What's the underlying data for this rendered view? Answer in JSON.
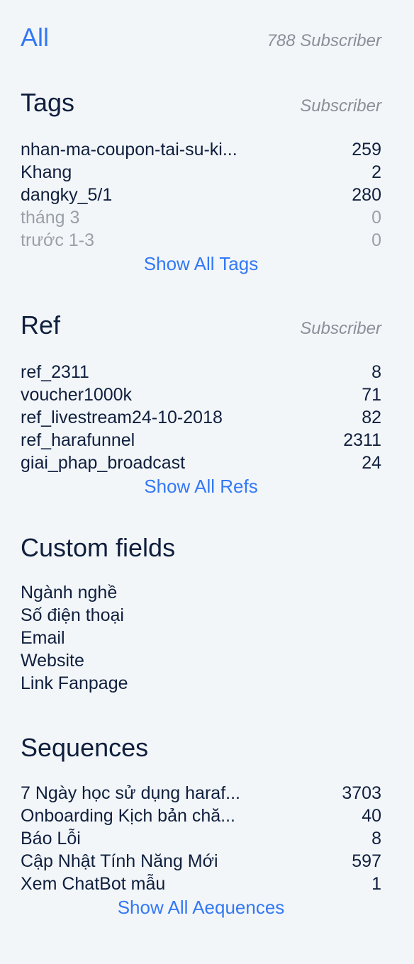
{
  "all": {
    "label": "All",
    "subscriber_text": "788 Subscriber"
  },
  "tags": {
    "title": "Tags",
    "column_label": "Subscriber",
    "items": [
      {
        "name": "nhan-ma-coupon-tai-su-ki...",
        "count": "259"
      },
      {
        "name": "Khang",
        "count": "2"
      },
      {
        "name": "dangky_5/1",
        "count": "280"
      },
      {
        "name": "tháng 3",
        "count": "0"
      },
      {
        "name": "trước 1-3",
        "count": "0"
      }
    ],
    "show_all": "Show All Tags"
  },
  "ref": {
    "title": "Ref",
    "column_label": "Subscriber",
    "items": [
      {
        "name": "ref_2311",
        "count": "8"
      },
      {
        "name": "voucher1000k",
        "count": "71"
      },
      {
        "name": "ref_livestream24-10-2018",
        "count": "82"
      },
      {
        "name": "ref_harafunnel",
        "count": "2311"
      },
      {
        "name": "giai_phap_broadcast",
        "count": "24"
      }
    ],
    "show_all": "Show All Refs"
  },
  "custom_fields": {
    "title": "Custom fields",
    "items": [
      "Ngành nghề",
      "Số điện thoại",
      "Email",
      "Website",
      "Link Fanpage"
    ]
  },
  "sequences": {
    "title": "Sequences",
    "items": [
      {
        "name": "7 Ngày học sử dụng haraf...",
        "count": "3703"
      },
      {
        "name": "Onboarding Kịch bản chă...",
        "count": "40"
      },
      {
        "name": "Báo Lỗi",
        "count": "8"
      },
      {
        "name": "Cập Nhật Tính Năng Mới",
        "count": "597"
      },
      {
        "name": "Xem ChatBot mẫu",
        "count": "1"
      }
    ],
    "show_all": "Show All Aequences"
  },
  "colors": {
    "background": "#f3f6f9",
    "text": "#0f1f3d",
    "accent": "#3378f6",
    "muted": "#9aa0a8"
  }
}
